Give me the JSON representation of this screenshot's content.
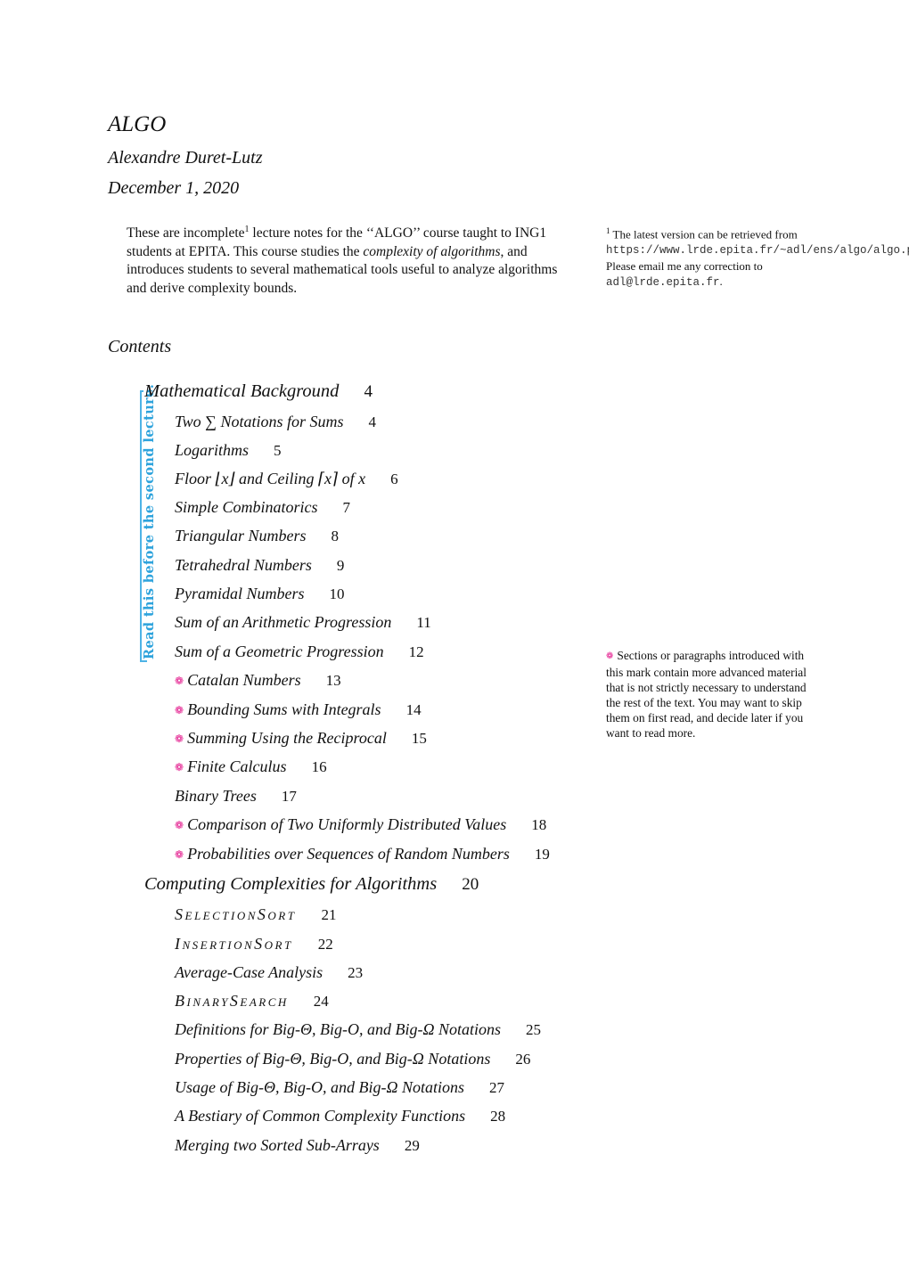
{
  "header": {
    "title": "ALGO",
    "author": "Alexandre Duret-Lutz",
    "date": "December 1, 2020"
  },
  "abstract": {
    "part1": "These are incomplete",
    "footnote_ref": "1",
    "part2": " lecture notes for the ‘‘ALGO’’ course taught to ING1 students at EPITA. This course studies the ",
    "emph": "complexity of algorithms",
    "part3": ", and introduces students to several mathematical tools useful to analyze algorithms and derive complexity bounds."
  },
  "footnote": {
    "number": "1",
    "text1": " The latest version can be retrieved from ",
    "url": "https://www.lrde.epita.fr/~adl/ens/algo/algo.pdf",
    "text2": ". Please email me any correction to ",
    "email": "adl@lrde.epita.fr",
    "text3": "."
  },
  "contents": {
    "heading": "Contents",
    "sidebar_note": "Read this before the second lecture.",
    "advanced_note": "Sections or paragraphs introduced with this mark contain more advanced material that is not strictly necessary to understand the rest of the text. You may want to skip them on first read, and decide later if you want to read more.",
    "advanced_mark_icon": "flower-icon",
    "colors": {
      "sidebar": "#2ea3dc",
      "advanced_mark": "#e3198c"
    },
    "entries": [
      {
        "level": "part",
        "title": "Mathematical Background",
        "page": "4"
      },
      {
        "level": "section",
        "title": "Two ∑ Notations for Sums",
        "page": "4"
      },
      {
        "level": "section",
        "title": "Logarithms",
        "page": "5"
      },
      {
        "level": "section",
        "title": "Floor ⌊x⌋ and Ceiling ⌈x⌉ of x",
        "page": "6"
      },
      {
        "level": "section",
        "title": "Simple Combinatorics",
        "page": "7"
      },
      {
        "level": "section",
        "title": "Triangular Numbers",
        "page": "8"
      },
      {
        "level": "section",
        "title": "Tetrahedral Numbers",
        "page": "9"
      },
      {
        "level": "section",
        "title": "Pyramidal Numbers",
        "page": "10"
      },
      {
        "level": "section",
        "title": "Sum of an Arithmetic Progression",
        "page": "11"
      },
      {
        "level": "section",
        "title": "Sum of a Geometric Progression",
        "page": "12"
      },
      {
        "level": "section",
        "advanced": true,
        "title": "Catalan Numbers",
        "page": "13"
      },
      {
        "level": "section",
        "advanced": true,
        "title": "Bounding Sums with Integrals",
        "page": "14"
      },
      {
        "level": "section",
        "advanced": true,
        "title": "Summing Using the Reciprocal",
        "page": "15"
      },
      {
        "level": "section",
        "advanced": true,
        "title": "Finite Calculus",
        "page": "16"
      },
      {
        "level": "section",
        "title": "Binary Trees",
        "page": "17"
      },
      {
        "level": "section",
        "advanced": true,
        "title": "Comparison of Two Uniformly Distributed Values",
        "page": "18"
      },
      {
        "level": "section",
        "advanced": true,
        "title": "Probabilities over Sequences of Random Numbers",
        "page": "19"
      },
      {
        "level": "part",
        "title": "Computing Complexities for Algorithms",
        "page": "20"
      },
      {
        "level": "section",
        "smallcaps": true,
        "title": "SelectionSort",
        "page": "21"
      },
      {
        "level": "section",
        "smallcaps": true,
        "title": "InsertionSort",
        "page": "22"
      },
      {
        "level": "section",
        "title": "Average-Case Analysis",
        "page": "23"
      },
      {
        "level": "section",
        "smallcaps": true,
        "title": "BinarySearch",
        "page": "24"
      },
      {
        "level": "section",
        "title": "Definitions for Big-Θ, Big-O, and Big-Ω Notations",
        "page": "25"
      },
      {
        "level": "section",
        "title": "Properties of Big-Θ, Big-O, and Big-Ω Notations",
        "page": "26"
      },
      {
        "level": "section",
        "title": "Usage of Big-Θ, Big-O, and Big-Ω Notations",
        "page": "27"
      },
      {
        "level": "section",
        "title": "A Bestiary of Common Complexity Functions",
        "page": "28"
      },
      {
        "level": "section",
        "title": "Merging two Sorted Sub-Arrays",
        "page": "29"
      }
    ]
  }
}
